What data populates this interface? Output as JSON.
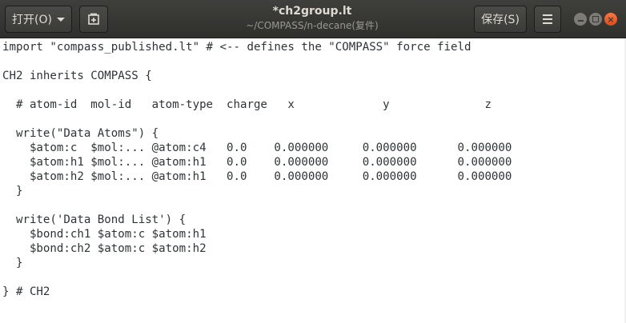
{
  "window": {
    "title": "*ch2group.lt",
    "subtitle": "~/COMPASS/n-decane(复件)"
  },
  "toolbar": {
    "open_label": "打开(O)",
    "open_caret_icon": "chevron-down-icon",
    "new_tab_icon": "new-document-icon",
    "save_label": "保存(S)",
    "menu_icon": "hamburger-menu-icon"
  },
  "window_controls": {
    "minimize_icon": "minimize-icon",
    "maximize_icon": "maximize-icon",
    "close_icon": "close-icon",
    "close_color": "#e95420"
  },
  "editor": {
    "lines": [
      "import \"compass_published.lt\" # <-- defines the \"COMPASS\" force field",
      "",
      "CH2 inherits COMPASS {",
      "",
      "  # atom-id  mol-id   atom-type  charge   x             y              z",
      "",
      "  write(\"Data Atoms\") {",
      "    $atom:c  $mol:... @atom:c4   0.0    0.000000     0.000000      0.000000",
      "    $atom:h1 $mol:... @atom:h1   0.0    0.000000     0.000000      0.000000",
      "    $atom:h2 $mol:... @atom:h1   0.0    0.000000     0.000000      0.000000",
      "  }",
      "",
      "  write('Data Bond List') {",
      "    $bond:ch1 $atom:c $atom:h1",
      "    $bond:ch2 $atom:c $atom:h2",
      "  }",
      "",
      "} # CH2"
    ]
  }
}
